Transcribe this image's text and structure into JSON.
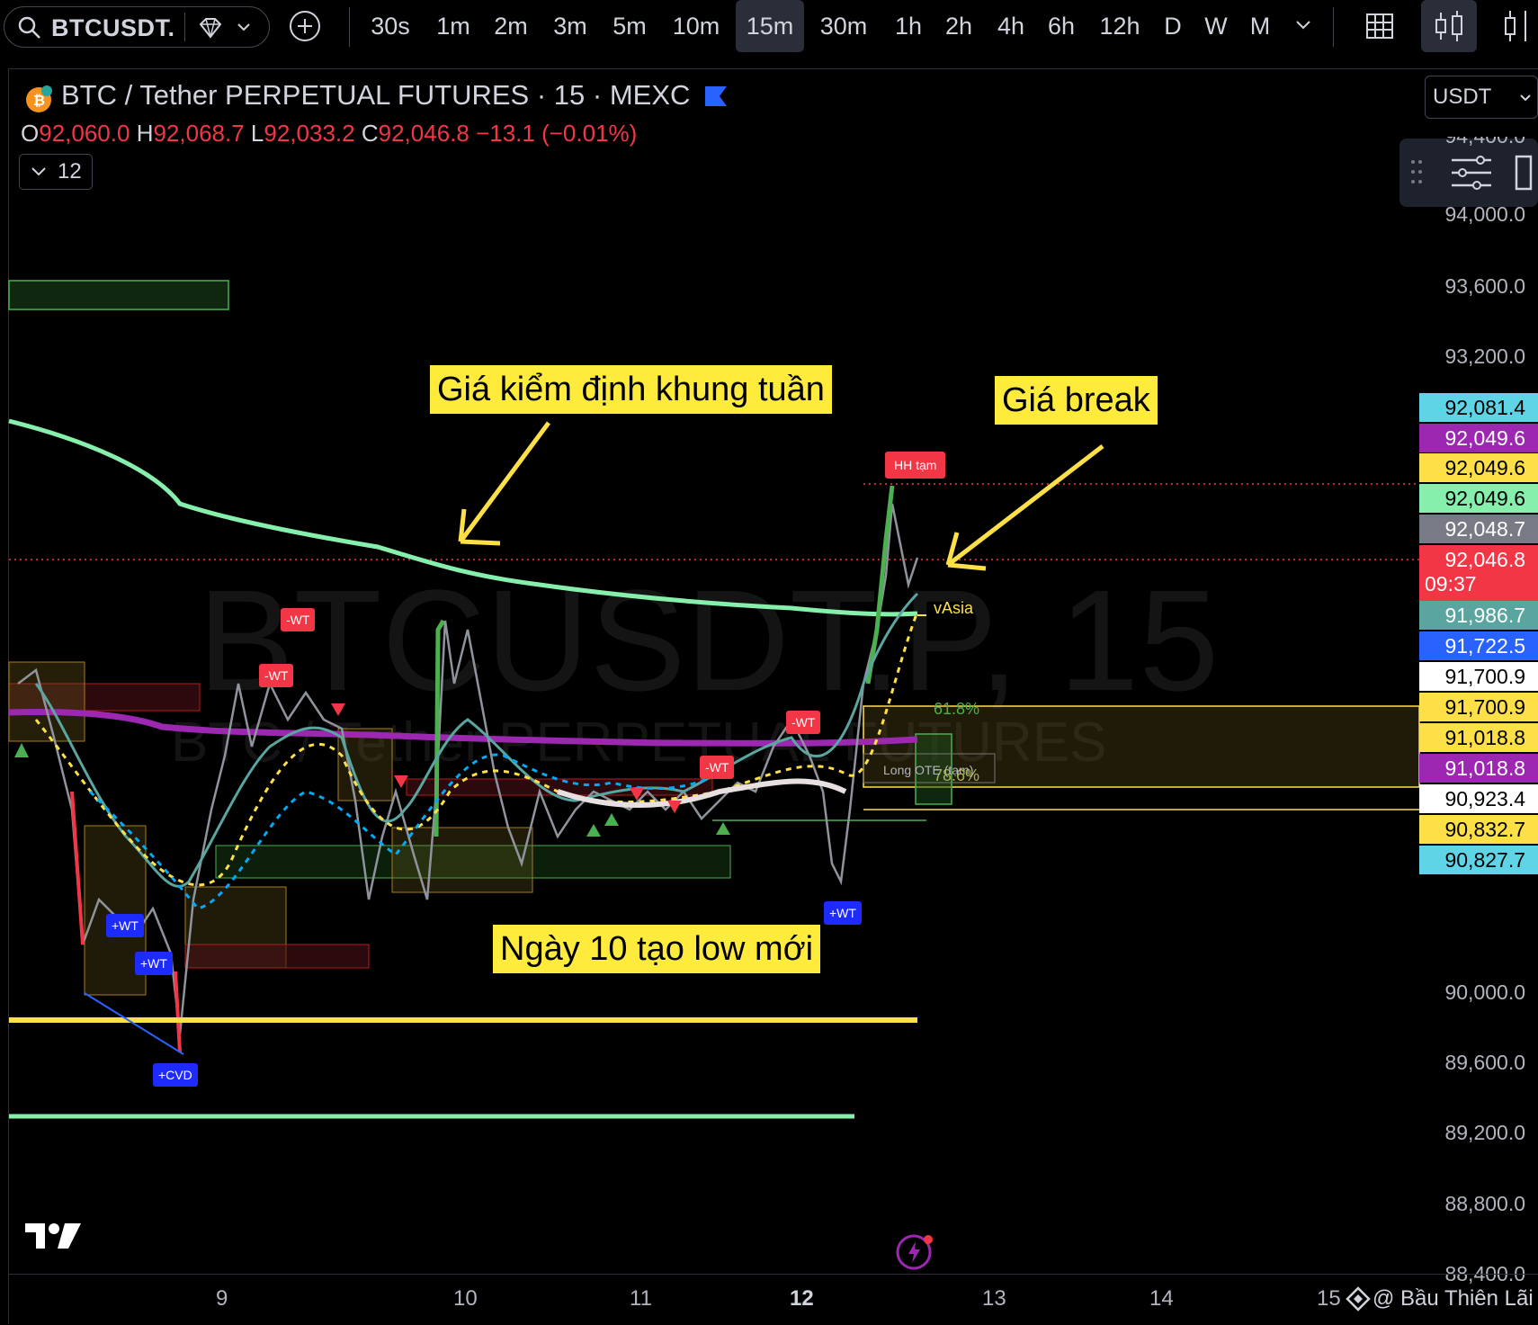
{
  "toolbar": {
    "symbol": "BTCUSDT.",
    "timeframes": [
      "30s",
      "1m",
      "2m",
      "3m",
      "5m",
      "10m",
      "15m",
      "30m",
      "1h",
      "2h",
      "4h",
      "6h",
      "12h",
      "D",
      "W",
      "M"
    ],
    "active_timeframe": "15m"
  },
  "legend": {
    "title": "BTC / Tether PERPETUAL FUTURES · 15 · MEXC",
    "o_label": "O",
    "o": "92,060.0",
    "h_label": "H",
    "h": "92,068.7",
    "l_label": "L",
    "l": "92,033.2",
    "c_label": "C",
    "c": "92,046.8",
    "change": "−13.1 (−0.01%)",
    "indicators_count": "12"
  },
  "watermark": {
    "line1": "BTCUSDT.P, 15",
    "line2": "BTC / Tether PERPETUAL FUTURES"
  },
  "currency": "USDT",
  "price_axis": [
    "94,400.0",
    "94,000.0",
    "93,600.0",
    "93,200.0",
    "90,000.0",
    "89,600.0",
    "89,200.0",
    "88,800.0",
    "88,400.0"
  ],
  "price_tags": [
    {
      "value": "92,081.4",
      "bg": "#5fd4e6",
      "fg": "#000"
    },
    {
      "value": "92,049.6",
      "bg": "#9c27b0",
      "fg": "#fff"
    },
    {
      "value": "92,049.6",
      "bg": "#fde047",
      "fg": "#000"
    },
    {
      "value": "92,049.6",
      "bg": "#86efac",
      "fg": "#000"
    },
    {
      "value": "92,048.7",
      "bg": "#787b86",
      "fg": "#fff"
    },
    {
      "value": "92,046.8",
      "bg": "#f23645",
      "fg": "#fff"
    },
    {
      "value": "91,986.7",
      "bg": "#5aa5a0",
      "fg": "#fff"
    },
    {
      "value": "91,722.5",
      "bg": "#2962ff",
      "fg": "#fff"
    },
    {
      "value": "91,700.9",
      "bg": "#ffffff",
      "fg": "#000"
    },
    {
      "value": "91,700.9",
      "bg": "#fde047",
      "fg": "#000"
    },
    {
      "value": "91,018.8",
      "bg": "#fde047",
      "fg": "#000"
    },
    {
      "value": "91,018.8",
      "bg": "#9c27b0",
      "fg": "#fff"
    },
    {
      "value": "90,923.4",
      "bg": "#ffffff",
      "fg": "#000"
    },
    {
      "value": "90,832.7",
      "bg": "#fde047",
      "fg": "#000"
    },
    {
      "value": "90,827.7",
      "bg": "#5fd4e6",
      "fg": "#000"
    }
  ],
  "countdown": "09:37",
  "time_axis": [
    "9",
    "10",
    "11",
    "12",
    "13",
    "14",
    "15"
  ],
  "credit": "@ Bầu Thiên Lãi",
  "annotations": {
    "weekly": "Giá kiểm định khung tuần",
    "break": "Giá break",
    "low": "Ngày 10 tạo low mới"
  },
  "signals": {
    "wt_minus": "-WT",
    "wt_plus": "+WT",
    "cvd_plus": "+CVD",
    "hh": "HH tạm",
    "vasia": "vAsia",
    "fib_618": "61.8%",
    "fib_786": "78.6%",
    "long_ote": "Long OTE (tạm)"
  }
}
